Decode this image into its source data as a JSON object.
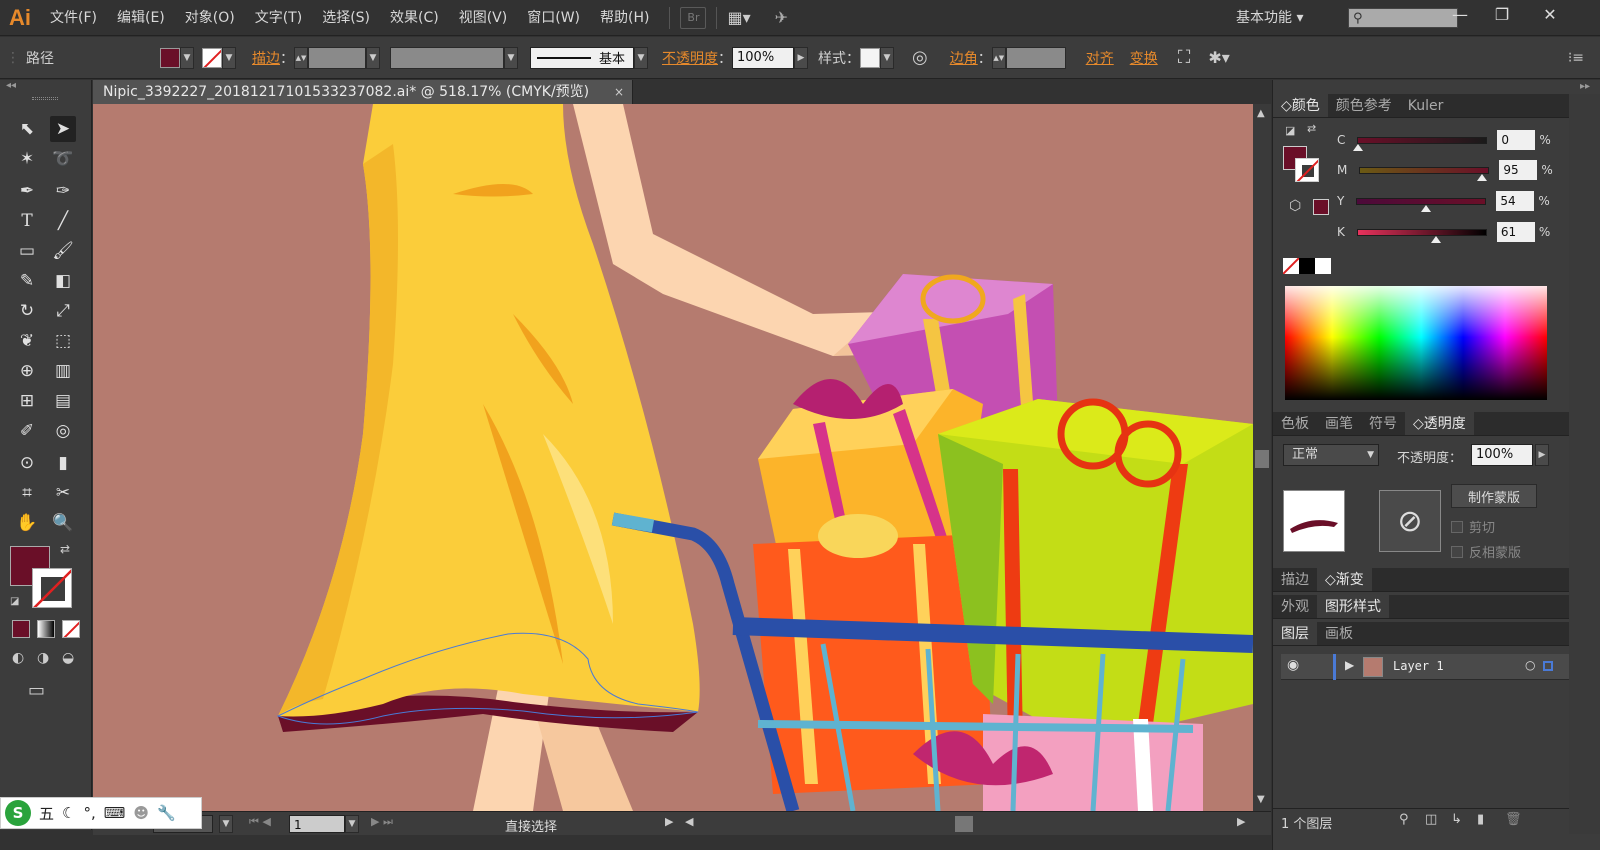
{
  "app": {
    "logo": "Ai",
    "menu": [
      "文件(F)",
      "编辑(E)",
      "对象(O)",
      "文字(T)",
      "选择(S)",
      "效果(C)",
      "视图(V)",
      "窗口(W)",
      "帮助(H)"
    ],
    "bridge_label": "Br",
    "workspace": "基本功能",
    "window_buttons": [
      "—",
      "❐",
      "✕"
    ]
  },
  "control_bar": {
    "selection_type": "路径",
    "fill_color": "#6a0f28",
    "stroke_link": "描边",
    "opacity_link": "不透明度",
    "opacity_value": "100%",
    "style_label": "样式",
    "stroke_profile": "基本",
    "corner_link": "边角",
    "align_link": "对齐",
    "transform_link": "变换"
  },
  "document": {
    "tab_title": "Nipic_3392227_20181217101533237082.ai* @ 518.17% (CMYK/预览)",
    "tab_close": "×",
    "canvas_bg": "#b57b6f"
  },
  "status_bar": {
    "zoom": "518.17",
    "artboard": "1",
    "tool_name": "直接选择"
  },
  "ime": {
    "logo": "S",
    "mode": "五"
  },
  "color_panel": {
    "tabs": [
      "颜色",
      "颜色参考",
      "Kuler"
    ],
    "channels": [
      {
        "label": "C",
        "value": "0",
        "pct": "%",
        "fraction": 0.0,
        "track": "linear-gradient(to right,#6a0f28,#1a1a1a)"
      },
      {
        "label": "M",
        "value": "95",
        "pct": "%",
        "fraction": 0.95,
        "track": "linear-gradient(to right,#6b5a14,#6a0f28)"
      },
      {
        "label": "Y",
        "value": "54",
        "pct": "%",
        "fraction": 0.54,
        "track": "linear-gradient(to right,#4c0a3a,#6a0f28)"
      },
      {
        "label": "K",
        "value": "61",
        "pct": "%",
        "fraction": 0.61,
        "track": "linear-gradient(to right,#e8325c,#000000)"
      }
    ]
  },
  "transparency_panel": {
    "tabs": [
      "色板",
      "画笔",
      "符号",
      "透明度"
    ],
    "blend_mode": "正常",
    "opacity_label": "不透明度：",
    "opacity_value": "100%",
    "make_mask": "制作蒙版",
    "clip": "剪切",
    "invert_mask": "反相蒙版"
  },
  "stroke_gradient_tabs": [
    "描边",
    "渐变"
  ],
  "appearance_tabs": [
    "外观",
    "图形样式"
  ],
  "layers_panel": {
    "tabs": [
      "图层",
      "画板"
    ],
    "layer_name": "Layer 1",
    "footer": "1 个图层"
  }
}
